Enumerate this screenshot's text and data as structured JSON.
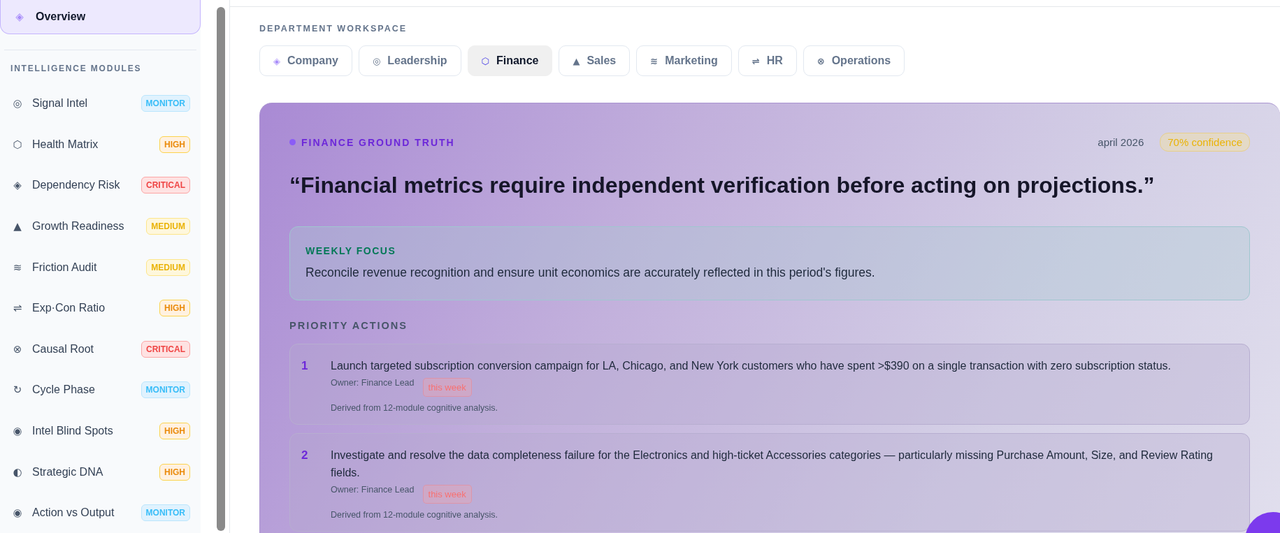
{
  "sidebar": {
    "overview": {
      "icon": "◈",
      "label": "Overview",
      "selected": true
    },
    "section_title": "INTELLIGENCE MODULES",
    "items": [
      {
        "icon": "◎",
        "label": "Signal Intel",
        "badge": "MONITOR",
        "kind": "monitor"
      },
      {
        "icon": "⬡",
        "label": "Health Matrix",
        "badge": "HIGH",
        "kind": "high"
      },
      {
        "icon": "◈",
        "label": "Dependency Risk",
        "badge": "CRITICAL",
        "kind": "critical"
      },
      {
        "icon": "▲",
        "label": "Growth Readiness",
        "badge": "MEDIUM",
        "kind": "medium"
      },
      {
        "icon": "≋",
        "label": "Friction Audit",
        "badge": "MEDIUM",
        "kind": "medium"
      },
      {
        "icon": "⇌",
        "label": "Exp·Con Ratio",
        "badge": "HIGH",
        "kind": "high"
      },
      {
        "icon": "⊗",
        "label": "Causal Root",
        "badge": "CRITICAL",
        "kind": "critical"
      },
      {
        "icon": "↻",
        "label": "Cycle Phase",
        "badge": "MONITOR",
        "kind": "monitor"
      },
      {
        "icon": "◉",
        "label": "Intel Blind Spots",
        "badge": "HIGH",
        "kind": "high"
      },
      {
        "icon": "◐",
        "label": "Strategic DNA",
        "badge": "HIGH",
        "kind": "high"
      },
      {
        "icon": "◉",
        "label": "Action vs Output",
        "badge": "MONITOR",
        "kind": "monitor"
      }
    ]
  },
  "workspace": {
    "title": "DEPARTMENT WORKSPACE",
    "tabs": [
      {
        "icon": "◈",
        "label": "Company",
        "selected": false
      },
      {
        "icon": "◎",
        "label": "Leadership",
        "selected": false
      },
      {
        "icon": "⬡",
        "label": "Finance",
        "selected": true
      },
      {
        "icon": "▲",
        "label": "Sales",
        "selected": false
      },
      {
        "icon": "≋",
        "label": "Marketing",
        "selected": false
      },
      {
        "icon": "⇌",
        "label": "HR",
        "selected": false
      },
      {
        "icon": "⊗",
        "label": "Operations",
        "selected": false
      }
    ]
  },
  "card": {
    "label": "FINANCE GROUND TRUTH",
    "date": "april 2026",
    "confidence": "70% confidence",
    "quote": "“Financial metrics require independent verification before acting on projections.”",
    "focus": {
      "title": "WEEKLY FOCUS",
      "text": "Reconcile revenue recognition and ensure unit economics are accurately reflected in this period's figures."
    },
    "actions_title": "PRIORITY ACTIONS",
    "actions": [
      {
        "number": "1",
        "text": "Launch targeted subscription conversion campaign for LA, Chicago, and New York customers who have spent >$390 on a single transaction with zero subscription status.",
        "owner": "Owner: Finance Lead",
        "timing": "this week",
        "note": "Derived from 12-module cognitive analysis."
      },
      {
        "number": "2",
        "text": "Investigate and resolve the data completeness failure for the Electronics and high-ticket Accessories categories — particularly missing Purchase Amount, Size, and Review Rating fields.",
        "owner": "Owner: Finance Lead",
        "timing": "this week",
        "note": "Derived from 12-module cognitive analysis."
      }
    ]
  }
}
